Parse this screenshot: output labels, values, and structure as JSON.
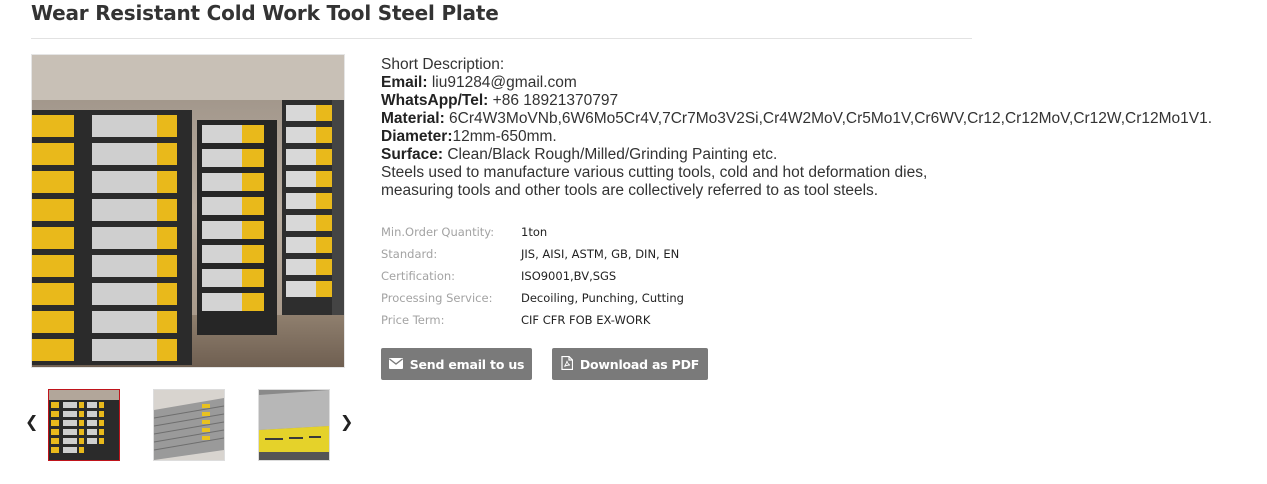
{
  "product": {
    "title": "Wear Resistant Cold Work Tool Steel Plate"
  },
  "description": {
    "short_label": "Short Description:",
    "email_label": "Email:",
    "email_value": " liu91284@gmail.com",
    "whatsapp_label": "WhatsApp/Tel:",
    "whatsapp_value": " +86 18921370797",
    "material_label": "Material:",
    "material_value": " 6Cr4W3MoVNb,6W6Mo5Cr4V,7Cr7Mo3V2Si,Cr4W2MoV,Cr5Mo1V,Cr6WV,Cr12,Cr12MoV,Cr12W,Cr12Mo1V1.",
    "diameter_label": "Diameter:",
    "diameter_value": "12mm-650mm.",
    "surface_label": "Surface:",
    "surface_value": " Clean/Black Rough/Milled/Grinding Painting etc.",
    "body_line1": "Steels used to manufacture various cutting tools, cold and hot deformation dies,",
    "body_line2": "measuring tools and other tools are collectively referred to as tool steels."
  },
  "specs": [
    {
      "label": "Min.Order Quantity:",
      "value": "1ton"
    },
    {
      "label": "Standard:",
      "value": "JIS, AISI, ASTM, GB, DIN, EN"
    },
    {
      "label": "Certification:",
      "value": "ISO9001,BV,SGS"
    },
    {
      "label": "Processing Service:",
      "value": "Decoiling, Punching, Cutting"
    },
    {
      "label": "Price Term:",
      "value": "CIF CFR FOB EX-WORK"
    }
  ],
  "buttons": {
    "email": "Send email to us",
    "pdf": "Download as PDF"
  },
  "icons": {
    "prev": "chevron-left-icon",
    "next": "chevron-right-icon",
    "email": "envelope-icon",
    "pdf": "pdf-file-icon"
  },
  "colors": {
    "button_bg": "#7a7a7a",
    "active_thumb_border": "#c0141b",
    "label_gray": "#a3a3a3",
    "paint_yellow": "#e8b81a"
  }
}
